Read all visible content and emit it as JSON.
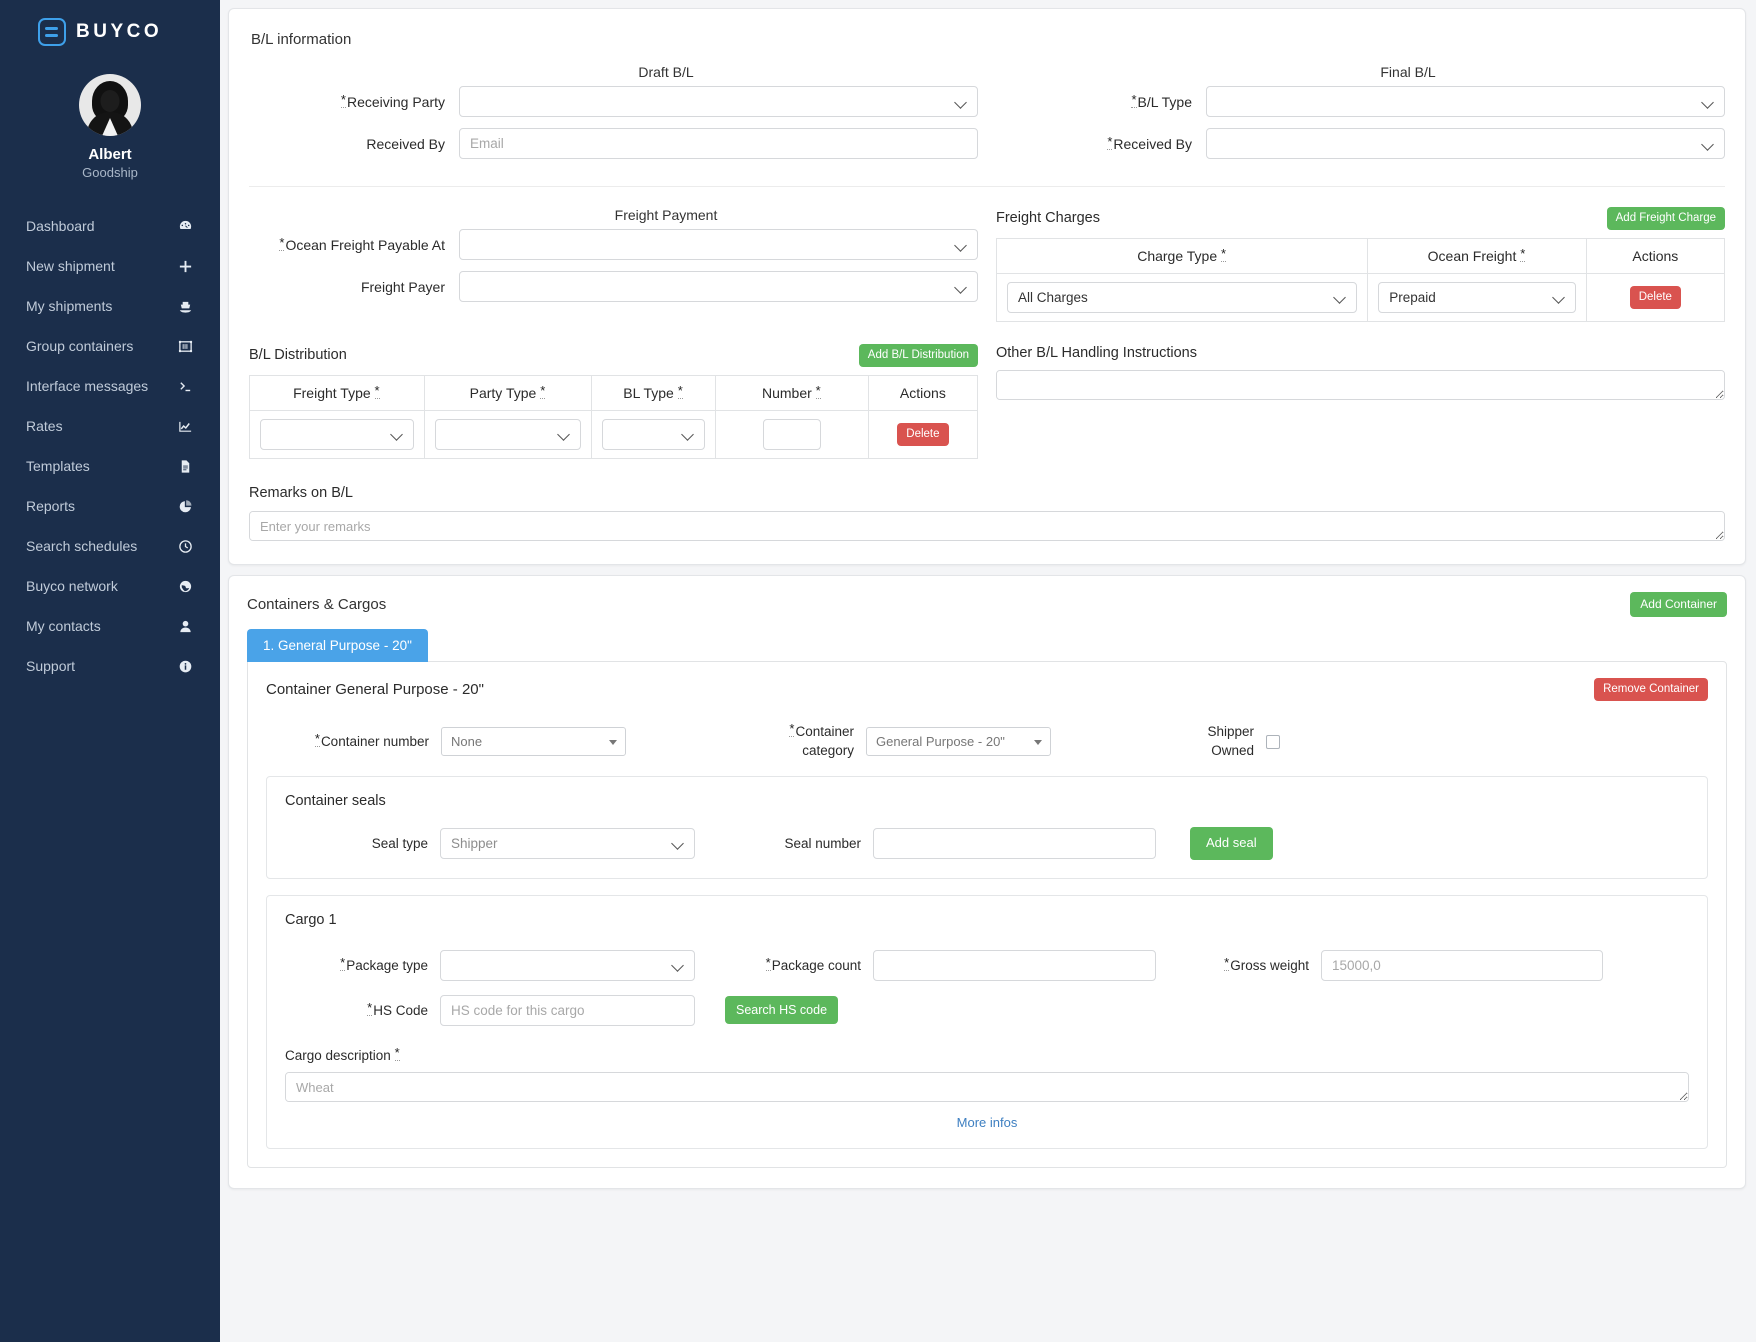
{
  "sidebar": {
    "brand": "BUYCO",
    "user": {
      "name": "Albert",
      "org": "Goodship"
    },
    "items": [
      {
        "label": "Dashboard",
        "icon": "dashboard-icon"
      },
      {
        "label": "New shipment",
        "icon": "plus-icon"
      },
      {
        "label": "My shipments",
        "icon": "ship-icon"
      },
      {
        "label": "Group containers",
        "icon": "container-group-icon"
      },
      {
        "label": "Interface messages",
        "icon": "terminal-icon"
      },
      {
        "label": "Rates",
        "icon": "chart-line-icon"
      },
      {
        "label": "Templates",
        "icon": "document-icon"
      },
      {
        "label": "Reports",
        "icon": "pie-chart-icon"
      },
      {
        "label": "Search schedules",
        "icon": "clock-icon"
      },
      {
        "label": "Buyco network",
        "icon": "globe-icon"
      },
      {
        "label": "My contacts",
        "icon": "user-icon"
      },
      {
        "label": "Support",
        "icon": "info-icon"
      }
    ]
  },
  "bl_information": {
    "section_title": "B/L information",
    "draft_bl": {
      "heading": "Draft B/L",
      "receiving_party_label": "Receiving Party",
      "receiving_party_value": "",
      "received_by_label": "Received By",
      "received_by_placeholder": "Email",
      "received_by_value": ""
    },
    "final_bl": {
      "heading": "Final B/L",
      "bl_type_label": "B/L Type",
      "bl_type_value": "",
      "received_by_label": "Received By",
      "received_by_value": ""
    },
    "freight_payment": {
      "heading": "Freight Payment",
      "ocean_freight_payable_at_label": "Ocean Freight Payable At",
      "ocean_freight_payable_at_value": "",
      "freight_payer_label": "Freight Payer",
      "freight_payer_value": ""
    },
    "freight_charges": {
      "heading": "Freight Charges",
      "add_button": "Add Freight Charge",
      "columns": [
        "Charge Type",
        "Ocean Freight",
        "Actions"
      ],
      "rows": [
        {
          "charge_type": "All Charges",
          "ocean_freight": "Prepaid",
          "action": "Delete"
        }
      ]
    },
    "bl_distribution": {
      "heading": "B/L Distribution",
      "add_button": "Add B/L Distribution",
      "columns": [
        "Freight Type",
        "Party Type",
        "BL Type",
        "Number",
        "Actions"
      ],
      "rows": [
        {
          "freight_type": "",
          "party_type": "",
          "bl_type": "",
          "number": "",
          "action": "Delete"
        }
      ]
    },
    "other_handling": {
      "heading": "Other B/L Handling Instructions",
      "value": ""
    },
    "remarks": {
      "heading": "Remarks on B/L",
      "placeholder": "Enter your remarks",
      "value": ""
    }
  },
  "containers_cargos": {
    "section_title": "Containers & Cargos",
    "add_container_button": "Add Container",
    "tabs": [
      {
        "label": "1. General Purpose - 20\"",
        "active": true
      }
    ],
    "panel": {
      "title": "Container General Purpose - 20\"",
      "remove_button": "Remove Container",
      "container_number_label": "Container number",
      "container_number_value": "None",
      "container_category_label": "Container category",
      "container_category_value": "General Purpose - 20\"",
      "shipper_owned_label": "Shipper Owned",
      "shipper_owned_checked": false,
      "seals": {
        "title": "Container seals",
        "seal_type_label": "Seal type",
        "seal_type_value": "Shipper",
        "seal_number_label": "Seal number",
        "seal_number_value": "",
        "add_seal_button": "Add seal"
      },
      "cargo": {
        "title": "Cargo 1",
        "package_type_label": "Package type",
        "package_type_value": "",
        "package_count_label": "Package count",
        "package_count_value": "",
        "gross_weight_label": "Gross weight",
        "gross_weight_placeholder": "15000,0",
        "gross_weight_value": "",
        "hs_code_label": "HS Code",
        "hs_code_placeholder": "HS code for this cargo",
        "hs_code_value": "",
        "search_hs_button": "Search HS code",
        "cargo_description_label": "Cargo description",
        "cargo_description_placeholder": "Wheat",
        "cargo_description_value": "",
        "more_infos": "More infos"
      }
    }
  },
  "colors": {
    "sidebar_bg": "#1b2e4b",
    "accent_blue": "#4aa3e8",
    "green": "#5cb85c",
    "red": "#d9534f",
    "link": "#3d7fc1"
  }
}
